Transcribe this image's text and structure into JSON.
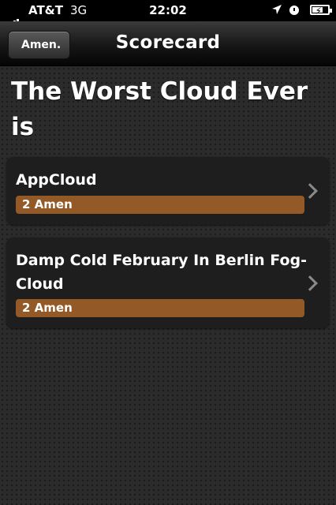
{
  "status_bar": {
    "carrier": "AT&T",
    "network": "3G",
    "time": "22:02",
    "icons": [
      "signal-icon",
      "location-icon",
      "alarm-icon",
      "battery-icon"
    ]
  },
  "nav": {
    "back_label": "Amen.",
    "title": "Scorecard"
  },
  "heading": "The Worst Cloud Ever is",
  "entries": [
    {
      "title": "AppCloud",
      "amen_count": "2 Amen"
    },
    {
      "title": "Damp Cold February In Berlin Fog-Cloud",
      "amen_count": "2 Amen"
    }
  ],
  "colors": {
    "amen_bar": "#935a28",
    "card_bg": "#1e1e1e",
    "background": "#2b2b2b"
  }
}
